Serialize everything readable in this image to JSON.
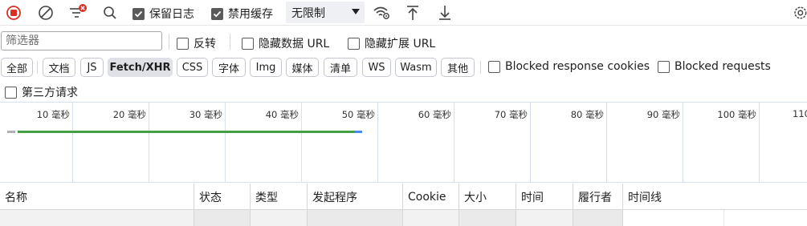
{
  "toolbar": {
    "record_icon": "record-stop-icon",
    "clear_icon": "clear-icon",
    "filter_icon": "filter-clear-icon",
    "search_icon": "search-icon",
    "preserve_log": {
      "label": "保留日志",
      "checked": true
    },
    "disable_cache": {
      "label": "禁用缓存",
      "checked": true
    },
    "throttling": {
      "value": "无限制"
    },
    "wifi_icon": "network-conditions-icon",
    "import_icon": "import-har-icon",
    "export_icon": "export-har-icon",
    "settings_icon": "gear-icon",
    "record_color": "#d93025"
  },
  "filter": {
    "placeholder": "筛选器",
    "invert": {
      "label": "反转",
      "checked": false
    },
    "hide_data_urls": {
      "label": "隐藏数据 URL",
      "checked": false
    },
    "hide_extension_urls": {
      "label": "隐藏扩展 URL",
      "checked": false
    }
  },
  "resource_types": [
    {
      "label": "全部",
      "active": false
    },
    {
      "label": "文档",
      "active": false
    },
    {
      "label": "JS",
      "active": false
    },
    {
      "label": "Fetch/XHR",
      "active": true
    },
    {
      "label": "CSS",
      "active": false
    },
    {
      "label": "字体",
      "active": false
    },
    {
      "label": "Img",
      "active": false
    },
    {
      "label": "媒体",
      "active": false
    },
    {
      "label": "清单",
      "active": false
    },
    {
      "label": "WS",
      "active": false
    },
    {
      "label": "Wasm",
      "active": false
    },
    {
      "label": "其他",
      "active": false
    }
  ],
  "extra_filters": {
    "blocked_cookies": {
      "label": "Blocked response cookies",
      "checked": false
    },
    "blocked_requests": {
      "label": "Blocked requests",
      "checked": false
    },
    "third_party": {
      "label": "第三方请求",
      "checked": false
    }
  },
  "overview": {
    "ticks": [
      "10 毫秒",
      "20 毫秒",
      "30 毫秒",
      "40 毫秒",
      "50 毫秒",
      "60 毫秒",
      "70 毫秒",
      "80 毫秒",
      "90 毫秒",
      "100 毫秒",
      "110"
    ],
    "colors": {
      "waiting": "#43a047",
      "download": "#4a8af0",
      "queued": "#b0b0b0"
    }
  },
  "table": {
    "columns": [
      "名称",
      "状态",
      "类型",
      "发起程序",
      "Cookie",
      "大小",
      "时间",
      "履行者",
      "时间线"
    ]
  }
}
